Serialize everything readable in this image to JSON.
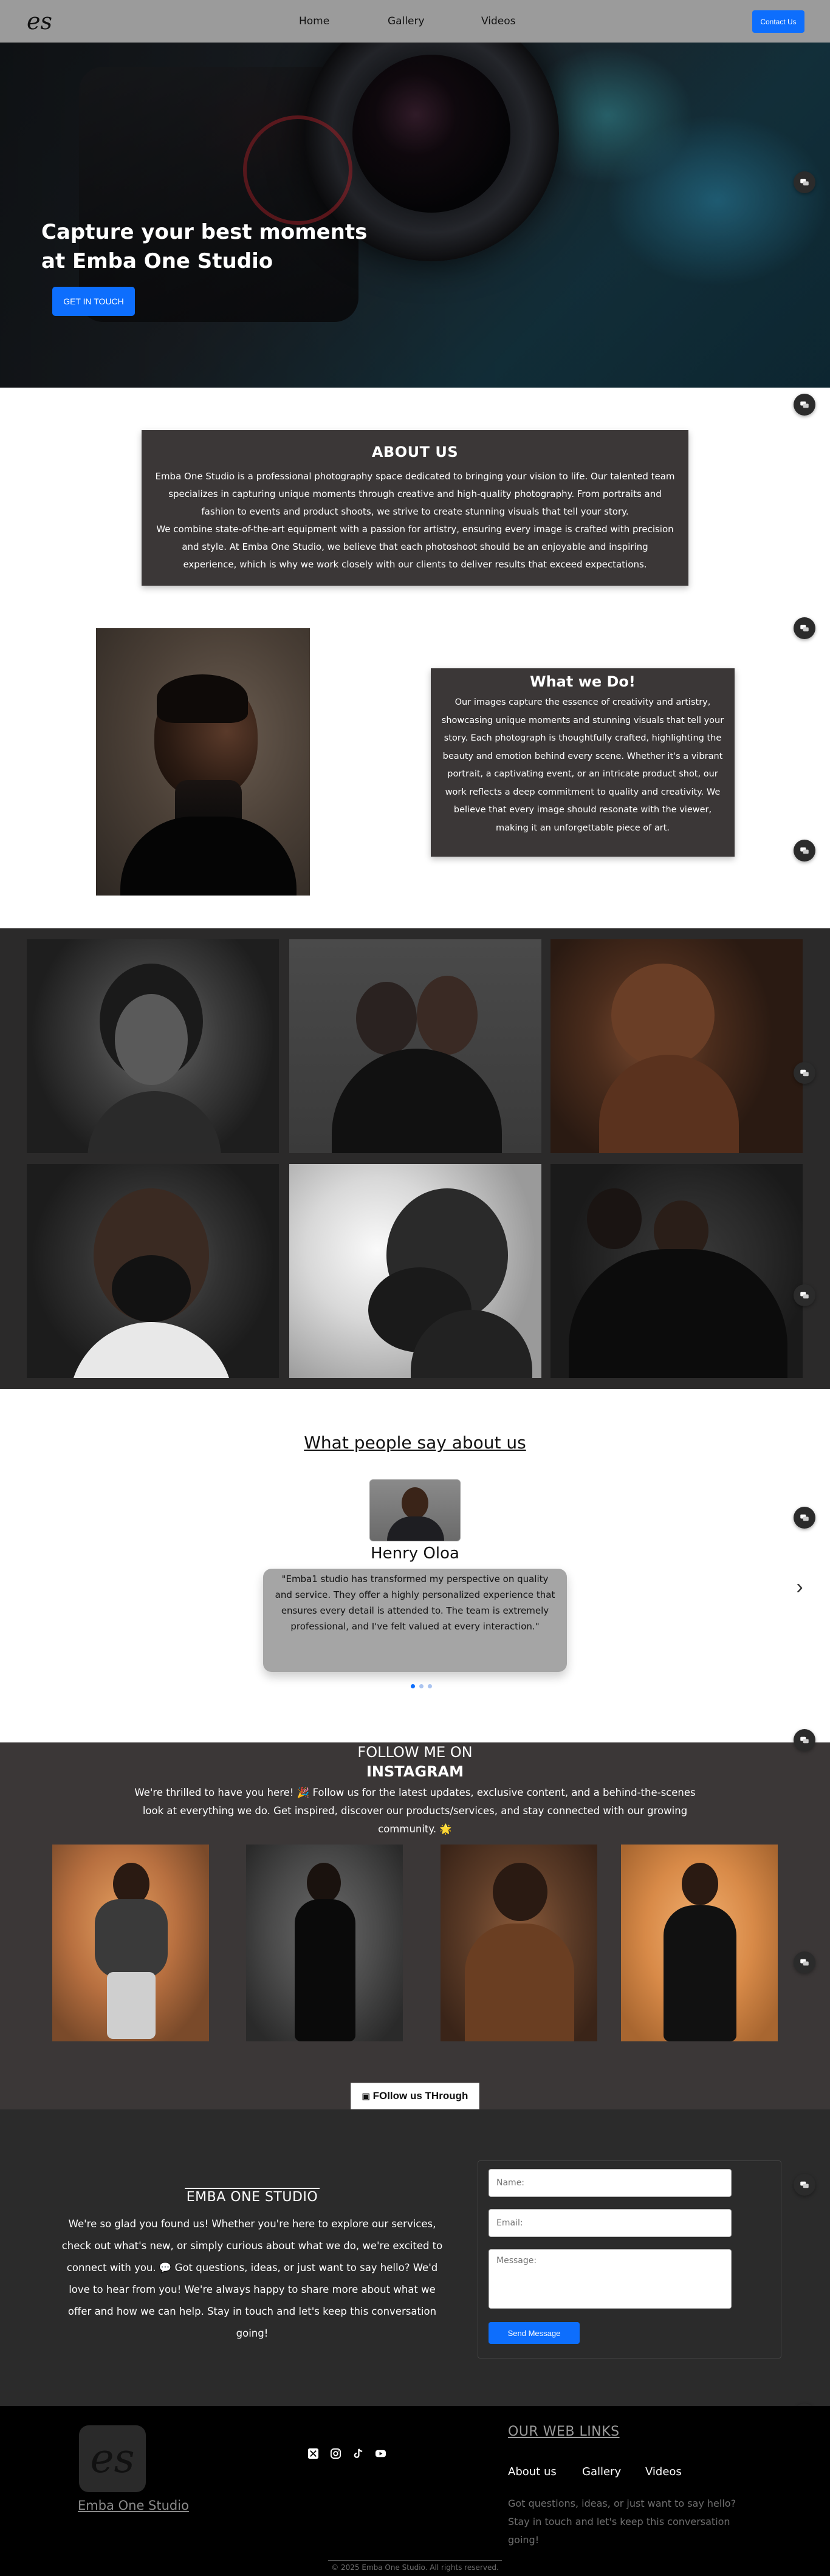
{
  "navbar": {
    "logo": "es",
    "links": [
      "Home",
      "Gallery",
      "Videos"
    ],
    "contact_label": "Contact Us"
  },
  "hero": {
    "title_line1": "Capture your best moments",
    "title_line2": "at Emba One Studio",
    "cta_label": "GET IN TOUCH"
  },
  "about": {
    "title": "ABOUT US",
    "paragraph1": "Emba One Studio is a professional photography space dedicated to bringing your vision to life. Our talented team specializes in capturing unique moments through creative and high-quality photography. From portraits and fashion to events and product shoots, we strive to create stunning visuals that tell your story.",
    "paragraph2": "We combine state-of-the-art equipment with a passion for artistry, ensuring every image is crafted with precision and style. At Emba One Studio, we believe that each photoshoot should be an enjoyable and inspiring experience, which is why we work closely with our clients to deliver results that exceed expectations."
  },
  "what_we_do": {
    "title": "What we Do!",
    "body": "Our images capture the essence of creativity and artistry, showcasing unique moments and stunning visuals that tell your story. Each photograph is thoughtfully crafted, highlighting the beauty and emotion behind every scene. Whether it's a vibrant portrait, a captivating event, or an intricate product shot, our work reflects a deep commitment to quality and creativity. We believe that every image should resonate with the viewer, making it an unforgettable piece of art."
  },
  "testimonials": {
    "title": "What people say about us",
    "name": "Henry Oloa",
    "quote": "\"Emba1 studio has transformed my perspective on quality and service. They offer a highly personalized experience that ensures every detail is attended to. The team is extremely professional, and I've felt valued at every interaction.\"",
    "next_arrow": "›"
  },
  "instagram": {
    "title_line1": "FOLLOW ME ON",
    "title_line2": "INSTAGRAM",
    "lead": "We're thrilled to have you here! 🎉 Follow us for the latest updates, exclusive content, and a behind-the-scenes look at everything we do. Get inspired, discover our products/services, and stay connected with our growing community. 🌟",
    "follow_label": "FOllow us THrough"
  },
  "contact": {
    "title": "EMBA ONE STUDIO",
    "blurb": "We're so glad you found us! Whether you're here to explore our services, check out what's new, or simply curious about what we do, we're excited to connect with you. 💬 Got questions, ideas, or just want to say hello? We'd love to hear from you! We're always happy to share more about what we offer and how we can help. Stay in touch and let's keep this conversation going!",
    "name_placeholder": "Name:",
    "email_placeholder": "Email:",
    "message_placeholder": "Message:",
    "send_label": "Send Message"
  },
  "footer": {
    "logo": "es",
    "brand": "Emba One Studio",
    "links_title": "OUR WEB LINKS",
    "links": [
      "About us",
      "Gallery",
      "Videos"
    ],
    "note": "Got questions, ideas, or just want to say hello? Stay in touch and let's keep this conversation going!",
    "copyright": "© 2025 Emba One Studio. All rights reserved."
  },
  "colors": {
    "accent": "#0d6efd",
    "panel": "#3b3737",
    "navbar": "#9b9b9b"
  }
}
